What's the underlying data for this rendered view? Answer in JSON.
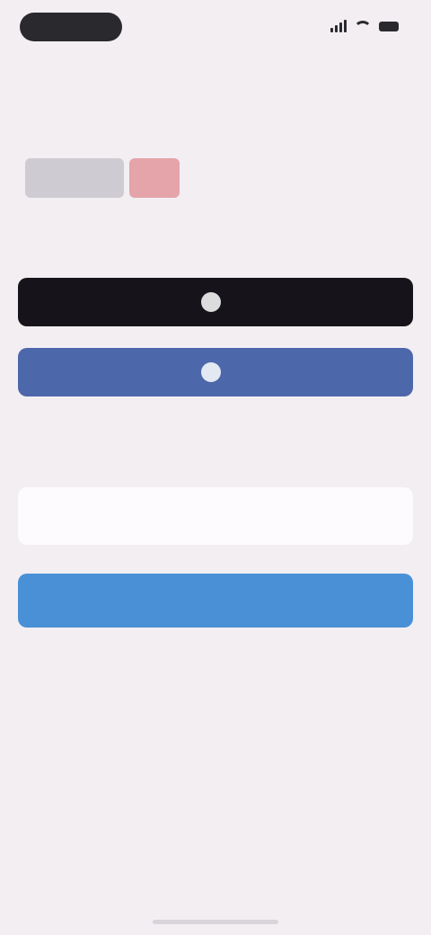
{
  "status_bar": {
    "time": ""
  },
  "header": {
    "title": ""
  },
  "welcome": {
    "heading": ""
  },
  "buttons": {
    "apple_label": "",
    "facebook_label": "",
    "continue_label": ""
  },
  "email": {
    "label": "",
    "placeholder": "",
    "value": ""
  },
  "legal": {
    "text": "",
    "terms_link": "",
    "privacy_link": ""
  },
  "colors": {
    "background": "#f2eef2",
    "apple_button": "#16141a",
    "facebook_button": "#4d67ab",
    "continue_button": "#4a90d6",
    "brand_accent": "#e4a4aa"
  },
  "icons": {
    "status": [
      "signal-icon",
      "wifi-icon",
      "battery-icon"
    ],
    "buttons": [
      "apple-icon",
      "facebook-icon"
    ]
  }
}
